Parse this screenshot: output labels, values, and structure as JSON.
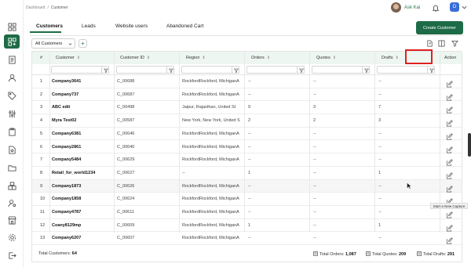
{
  "breadcrumb": {
    "root": "Dashboard",
    "current": "Customer"
  },
  "user": {
    "name": "Ask Kai",
    "avatar_letter": "D"
  },
  "tabs": [
    "Customers",
    "Leads",
    "Website users",
    "Abandoned Cart"
  ],
  "create_button": "Create Customer",
  "filter": {
    "selected": "All Customers"
  },
  "columns": [
    "#",
    "Customer",
    "Customer ID",
    "Region",
    "Orders",
    "Quotes",
    "Drafts",
    "Action"
  ],
  "rows": [
    {
      "n": "1",
      "customer": "Company3641",
      "id": "C_00688",
      "region": "RockfordRockford, MichiganA",
      "orders": "--",
      "quotes": "--",
      "drafts": "--"
    },
    {
      "n": "2",
      "customer": "Company737",
      "id": "C_00687",
      "region": "RockfordRockford, MichiganA",
      "orders": "--",
      "quotes": "--",
      "drafts": "--"
    },
    {
      "n": "3",
      "customer": "ABC edit",
      "id": "C_00498",
      "region": "Jaipur, Rajasthan, United St",
      "orders": "9",
      "quotes": "3",
      "drafts": "7"
    },
    {
      "n": "4",
      "customer": "Myra Test02",
      "id": "C_00587",
      "region": "New York, New York, United S",
      "orders": "2",
      "quotes": "2",
      "drafts": "3"
    },
    {
      "n": "5",
      "customer": "Company6381",
      "id": "C_00646",
      "region": "RockfordRockford, MichiganA",
      "orders": "--",
      "quotes": "--",
      "drafts": "--"
    },
    {
      "n": "6",
      "customer": "Company2861",
      "id": "C_00640",
      "region": "RockfordRockford, MichiganA",
      "orders": "--",
      "quotes": "--",
      "drafts": "--"
    },
    {
      "n": "7",
      "customer": "Company5484",
      "id": "C_00629",
      "region": "RockfordRockford, MichiganA",
      "orders": "--",
      "quotes": "--",
      "drafts": "--"
    },
    {
      "n": "8",
      "customer": "Retail_for_world1234",
      "id": "C_00627",
      "region": "--",
      "orders": "1",
      "quotes": "--",
      "drafts": "1"
    },
    {
      "n": "9",
      "customer": "Company1873",
      "id": "C_00626",
      "region": "RockfordRockford, MichiganA",
      "orders": "--",
      "quotes": "--",
      "drafts": "--"
    },
    {
      "n": "10",
      "customer": "Company1858",
      "id": "C_00624",
      "region": "RockfordRockford, MichiganA",
      "orders": "--",
      "quotes": "--",
      "drafts": "--"
    },
    {
      "n": "11",
      "customer": "Company4787",
      "id": "C_00611",
      "region": "RockfordRockford, MichiganA",
      "orders": "--",
      "quotes": "--",
      "drafts": "--"
    },
    {
      "n": "12",
      "customer": "Coany8129mp",
      "id": "C_00609",
      "region": "RockfordRockford, MichiganA",
      "orders": "1",
      "quotes": "--",
      "drafts": "1"
    },
    {
      "n": "13",
      "customer": "Company6207",
      "id": "C_00607",
      "region": "RockfordRockford, MichiganA",
      "orders": "--",
      "quotes": "--",
      "drafts": "--"
    }
  ],
  "tooltip": "Start a New Capture",
  "footer": {
    "total_customers_label": "Total Customers:",
    "total_customers": "64",
    "total_orders_label": "Total Orders:",
    "total_orders": "1,087",
    "total_quotes_label": "Total Quotes:",
    "total_quotes": "209",
    "total_drafts_label": "Total Drafts:",
    "total_drafts": "291"
  },
  "colors": {
    "brand": "#1e6b47",
    "header_bg": "#edf6f1",
    "highlight": "#e02020"
  }
}
